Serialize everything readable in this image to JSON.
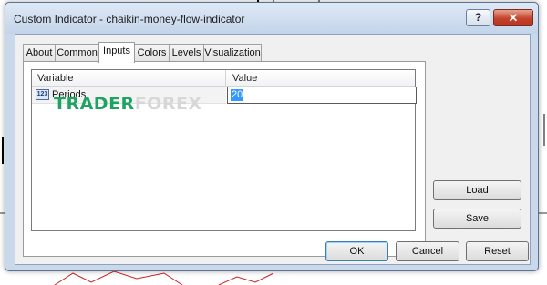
{
  "window": {
    "title": "Custom Indicator - chaikin-money-flow-indicator",
    "help_glyph": "?",
    "close_glyph": "✕"
  },
  "tabs": [
    {
      "label": "About"
    },
    {
      "label": "Common"
    },
    {
      "label": "Inputs",
      "active": true
    },
    {
      "label": "Colors"
    },
    {
      "label": "Levels"
    },
    {
      "label": "Visualization"
    }
  ],
  "inputs_grid": {
    "headers": {
      "variable": "Variable",
      "value": "Value"
    },
    "rows": [
      {
        "icon": "integer-type-icon",
        "icon_text": "123",
        "variable": "Periods",
        "value": "20"
      }
    ]
  },
  "watermark": {
    "part_a": "TRADER",
    "part_b": "FOREX"
  },
  "side_buttons": {
    "load": "Load",
    "save": "Save"
  },
  "footer_buttons": {
    "ok": "OK",
    "cancel": "Cancel",
    "reset": "Reset"
  },
  "colors": {
    "titlebar": "#c3d4ea",
    "close": "#c4432c",
    "selection": "#3399ff",
    "watermark_green": "#1fa363"
  }
}
